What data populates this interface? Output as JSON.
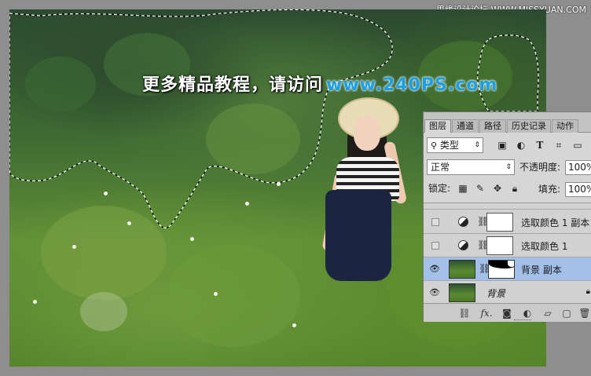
{
  "top_watermark": "思缘设计论坛 WWW.MISSYUAN.COM",
  "promo": {
    "chinese": "更多精品教程，请访问",
    "url": "www.240PS.com"
  },
  "layers_panel": {
    "tabs": [
      "图层",
      "通道",
      "路径",
      "历史记录",
      "动作"
    ],
    "kind_filter": "类型",
    "filter_icons": [
      "image-filter-icon",
      "adjustment-filter-icon",
      "text-filter-icon",
      "shape-filter-icon",
      "smart-object-filter-icon"
    ],
    "blend_mode": "正常",
    "opacity_label": "不透明度:",
    "opacity_value": "100%",
    "lock_label": "锁定:",
    "fill_label": "填充:",
    "fill_value": "100%",
    "layers": [
      {
        "name": "选取颜色 1 副本",
        "type": "adjustment",
        "visible": false,
        "selected": false
      },
      {
        "name": "选取颜色 1",
        "type": "adjustment",
        "visible": false,
        "selected": false
      },
      {
        "name": "背景 副本",
        "type": "image-with-mask",
        "visible": true,
        "selected": true
      },
      {
        "name": "背景",
        "type": "background",
        "visible": true,
        "selected": false,
        "locked": true
      }
    ],
    "bottom_icons": [
      "link-layers-icon",
      "fx-icon",
      "add-mask-icon",
      "new-adjustment-icon",
      "new-group-icon",
      "new-layer-icon",
      "delete-layer-icon"
    ],
    "fx_label": "fx."
  },
  "colors": {
    "panel_bg": "#d6d6d6",
    "selected_layer": "#a3c0e9",
    "url_blue": "#1aa0e8",
    "workspace_gray": "#8e8e8e"
  }
}
